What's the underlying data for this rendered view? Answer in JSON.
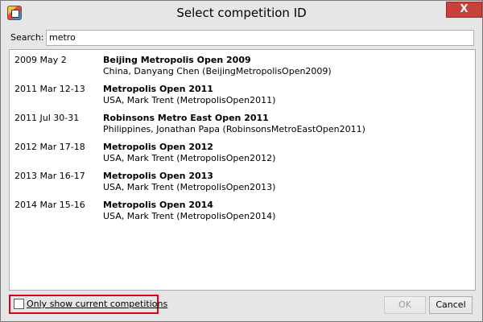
{
  "window": {
    "title": "Select competition ID",
    "close_label": "X"
  },
  "search": {
    "label": "Search:",
    "value": "metro"
  },
  "competitions": [
    {
      "date": "2009 May 2",
      "name": "Beijing Metropolis Open 2009",
      "detail": "China, Danyang Chen (BeijingMetropolisOpen2009)"
    },
    {
      "date": "2011 Mar 12-13",
      "name": "Metropolis Open 2011",
      "detail": "USA, Mark Trent (MetropolisOpen2011)"
    },
    {
      "date": "2011 Jul 30-31",
      "name": "Robinsons Metro East Open 2011",
      "detail": "Philippines, Jonathan Papa (RobinsonsMetroEastOpen2011)"
    },
    {
      "date": "2012 Mar 17-18",
      "name": "Metropolis Open 2012",
      "detail": "USA, Mark Trent (MetropolisOpen2012)"
    },
    {
      "date": "2013 Mar 16-17",
      "name": "Metropolis Open 2013",
      "detail": "USA, Mark Trent (MetropolisOpen2013)"
    },
    {
      "date": "2014 Mar 15-16",
      "name": "Metropolis Open 2014",
      "detail": "USA, Mark Trent (MetropolisOpen2014)"
    }
  ],
  "footer": {
    "checkbox_label": "Only show current competitions",
    "checkbox_checked": false,
    "ok_label": "OK",
    "ok_enabled": false,
    "cancel_label": "Cancel"
  },
  "colors": {
    "close_button": "#c7423a",
    "highlight": "#d9001b"
  }
}
